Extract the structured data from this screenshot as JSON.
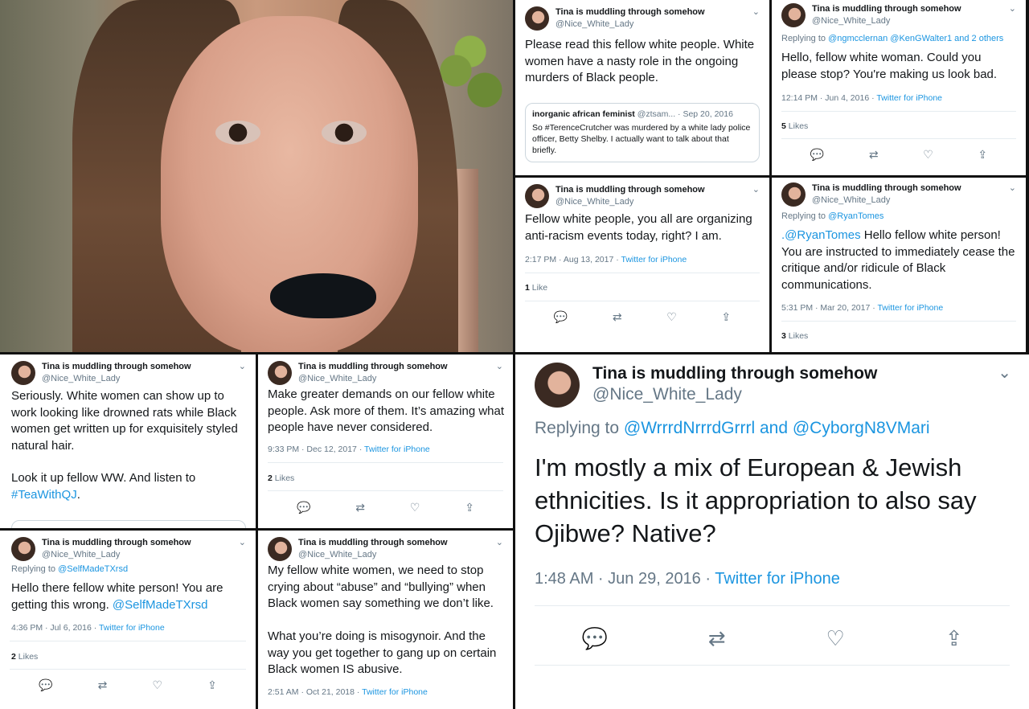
{
  "author": {
    "name": "Tina is muddling through somehow",
    "handle": "@Nice_White_Lady"
  },
  "icons": {
    "chevron": "chevron-down-icon",
    "reply": "reply-icon",
    "retweet": "retweet-icon",
    "like": "heart-icon",
    "share": "share-icon"
  },
  "colors": {
    "link": "#1b95e0",
    "muted": "#657786",
    "text": "#14171a"
  },
  "tweets": {
    "t1": {
      "text": "Please read this fellow white people. White women have a nasty role in the ongoing murders of Black people.",
      "quote": {
        "name": "inorganic african feminist",
        "handle": "@ztsam...",
        "date": "· Sep 20, 2016",
        "text": "So #TerenceCrutcher was murdered by a white lady police officer, Betty Shelby. I actually want to talk about that briefly."
      }
    },
    "t2": {
      "reply_prefix": "Replying to",
      "reply_to": "@ngmcclernan @KenGWalter1 and 2 others",
      "text": "Hello, fellow white woman. Could you please stop? You're making us look bad.",
      "time": "12:14 PM · Jun 4, 2016 ·",
      "source": "Twitter for iPhone",
      "likes_count": "5",
      "likes_label": "Likes"
    },
    "t3": {
      "text": "Fellow white people, you all are organizing anti-racism events today, right? I am.",
      "time": "2:17 PM · Aug 13, 2017 ·",
      "source": "Twitter for iPhone",
      "likes_count": "1",
      "likes_label": "Like"
    },
    "t4": {
      "reply_prefix": "Replying to",
      "reply_to": "@RyanTomes",
      "mention": ".@RyanTomes",
      "text": " Hello fellow white person! You are instructed to immediately cease the critique and/or ridicule of Black communications.",
      "time": "5:31 PM · Mar 20, 2017 ·",
      "source": "Twitter for iPhone",
      "likes_count": "3",
      "likes_label": "Likes"
    },
    "t5": {
      "text": "Seriously. White women can show up to work looking like drowned rats while Black women get written up for exquisitely styled natural hair.",
      "text2": "Look it up fellow WW. And listen to",
      "hashtag": "#TeaWithQJ",
      "end": "."
    },
    "t6": {
      "text": "Make greater demands on our fellow white people. Ask more of them. It’s amazing what people have never considered.",
      "time": "9:33 PM · Dec 12, 2017 ·",
      "source": "Twitter for iPhone",
      "likes_count": "2",
      "likes_label": "Likes"
    },
    "t7": {
      "reply_prefix": "Replying to",
      "reply_to": "@SelfMadeTXrsd",
      "text": "Hello there fellow white person! You are getting this wrong.",
      "mention": "@SelfMadeTXrsd",
      "time": "4:36 PM · Jul 6, 2016 ·",
      "source": "Twitter for iPhone",
      "likes_count": "2",
      "likes_label": "Likes"
    },
    "t8": {
      "text": "My fellow white women, we need to stop crying about “abuse” and “bullying” when Black women say something we don’t like.",
      "text2": "What you’re doing is misogynoir. And the way you get together to gang up on certain Black women IS abusive.",
      "time": "2:51 AM · Oct 21, 2018 ·",
      "source": "Twitter for iPhone"
    },
    "t9": {
      "reply_prefix": "Replying to",
      "reply_to": "@WrrrdNrrrdGrrrl and @CyborgN8VMari",
      "text": "I'm mostly a mix of European & Jewish ethnicities. Is it appropriation to also say Ojibwe?  Native?",
      "time": "1:48 AM · Jun 29, 2016 ·",
      "source": "Twitter for iPhone"
    }
  }
}
